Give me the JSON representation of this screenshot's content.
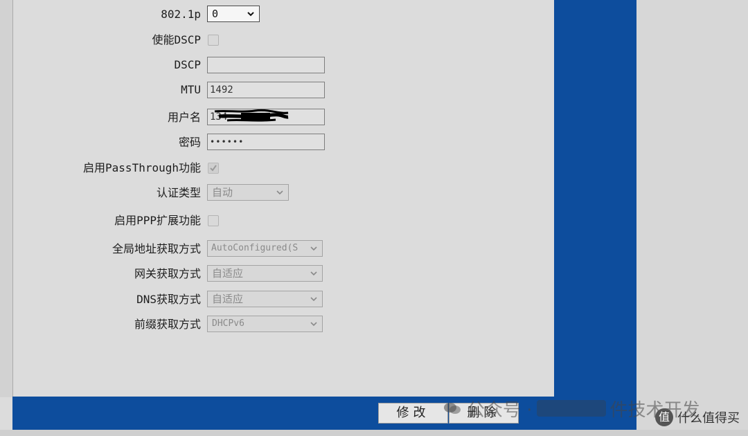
{
  "form": {
    "vlan_priority": {
      "label": "802.1p",
      "value": "0"
    },
    "enable_dscp": {
      "label": "使能DSCP",
      "checked": false
    },
    "dscp": {
      "label": "DSCP",
      "value": ""
    },
    "mtu": {
      "label": "MTU",
      "value": "1492"
    },
    "username": {
      "label": "用户名",
      "value": "134"
    },
    "password": {
      "label": "密码",
      "value": "••••••"
    },
    "passthrough": {
      "label": "启用PassThrough功能",
      "checked": true
    },
    "auth_type": {
      "label": "认证类型",
      "value": "自动"
    },
    "ppp_ext": {
      "label": "启用PPP扩展功能",
      "checked": false
    },
    "global_addr": {
      "label": "全局地址获取方式",
      "value": "AutoConfigured(S"
    },
    "gateway": {
      "label": "网关获取方式",
      "value": "自适应"
    },
    "dns": {
      "label": "DNS获取方式",
      "value": "自适应"
    },
    "prefix": {
      "label": "前缀获取方式",
      "value": "DHCPv6"
    }
  },
  "buttons": {
    "modify": "修改",
    "delete": "删除"
  },
  "watermark": {
    "prefix": "公众号 ·",
    "suffix": "件技术开发"
  },
  "corner_logo": {
    "text": "什么值得买",
    "icon_char": "值"
  },
  "colors": {
    "frame_blue": "#0d4d9d",
    "panel_gray": "#dcdcdc"
  }
}
